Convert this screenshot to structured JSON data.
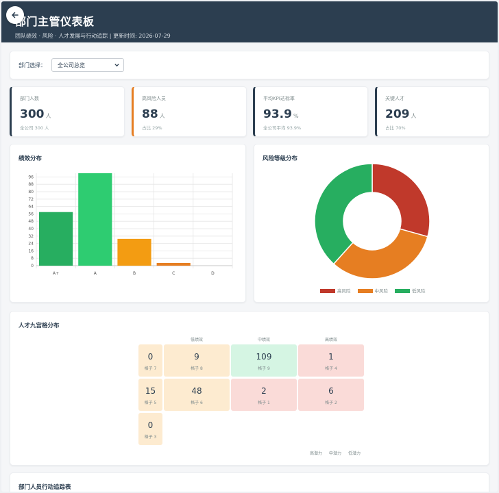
{
  "header": {
    "title": "部门主管仪表板",
    "subtitle": "团队绩效 · 风险 · 人才发展与行动追踪 | 更新时间: 2026-07-29"
  },
  "filter": {
    "label": "部门选择：",
    "selected": "全公司总览"
  },
  "kpis": [
    {
      "title": "部门人数",
      "value": "300",
      "unit": "人",
      "note": "全公司 300 人",
      "accent": "#2c3e50"
    },
    {
      "title": "高风险人员",
      "value": "88",
      "unit": "人",
      "note": "占比 29%",
      "accent": "#e67e22"
    },
    {
      "title": "平均KPI达标率",
      "value": "93.9",
      "unit": "%",
      "note": "全公司平均 93.9%",
      "accent": "#2c3e50"
    },
    {
      "title": "关键人才",
      "value": "209",
      "unit": "人",
      "note": "占比 70%",
      "accent": "#2c3e50"
    }
  ],
  "performance": {
    "title": "绩效分布"
  },
  "risk": {
    "title": "风险等级分布",
    "legend": [
      {
        "label": "高风险",
        "color": "#c0392b"
      },
      {
        "label": "中风险",
        "color": "#e67e22"
      },
      {
        "label": "低风险",
        "color": "#27ae60"
      }
    ]
  },
  "nine_box": {
    "title": "人才九宫格分布",
    "col_headers": [
      "低绩效",
      "中绩效",
      "高绩效"
    ],
    "row_footer": [
      "高潜力",
      "中潜力",
      "低潜力"
    ],
    "cells": [
      {
        "value": "0",
        "label": "格子 7",
        "tone": "y"
      },
      {
        "value": "9",
        "label": "格子 8",
        "tone": "y"
      },
      {
        "value": "109",
        "label": "格子 9",
        "tone": "gr"
      },
      {
        "value": "1",
        "label": "格子 4",
        "tone": "r"
      },
      {
        "value": "15",
        "label": "格子 5",
        "tone": "y"
      },
      {
        "value": "48",
        "label": "格子 6",
        "tone": "y"
      },
      {
        "value": "2",
        "label": "格子 1",
        "tone": "r"
      },
      {
        "value": "6",
        "label": "格子 2",
        "tone": "r"
      },
      {
        "value": "0",
        "label": "格子 3",
        "tone": "y"
      }
    ]
  },
  "table": {
    "title": "部门人员行动追踪表"
  },
  "chart_data": [
    {
      "type": "bar",
      "categories": [
        "A+",
        "A",
        "B",
        "C",
        "D"
      ],
      "values": [
        58,
        100,
        29,
        3,
        0
      ],
      "colors": [
        "#27ae60",
        "#2ecc71",
        "#f39c12",
        "#e67e22",
        "#c0392b"
      ],
      "ylim": [
        0,
        100
      ],
      "yticks": [
        0,
        8,
        16,
        24,
        32,
        40,
        48,
        56,
        64,
        72,
        80,
        88,
        96
      ],
      "ytick_labels": [
        "0",
        "8",
        "16",
        "24",
        "32",
        "40",
        "48",
        "56",
        "64",
        "72",
        "80",
        "88",
        "96"
      ],
      "grid": true
    },
    {
      "type": "pie",
      "donut": true,
      "categories": [
        "高风险",
        "中风险",
        "低风险"
      ],
      "values": [
        88,
        97,
        115
      ],
      "colors": [
        "#c0392b",
        "#e67e22",
        "#27ae60"
      ]
    }
  ]
}
